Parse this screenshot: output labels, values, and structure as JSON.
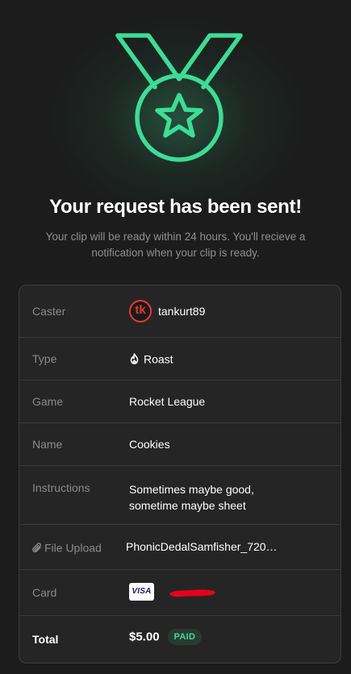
{
  "success": {
    "title": "Your request has been sent!",
    "subtitle": "Your clip will be ready within 24 hours. You'll recieve a notification when your clip is ready."
  },
  "details": {
    "caster_label": "Caster",
    "caster_value": "tankurt89",
    "caster_avatar_text": "tk",
    "type_label": "Type",
    "type_value": "Roast",
    "type_icon": "fire-icon",
    "game_label": "Game",
    "game_value": "Rocket League",
    "name_label": "Name",
    "name_value": "Cookies",
    "instructions_label": "Instructions",
    "instructions_line1": "Sometimes maybe good,",
    "instructions_line2": "sometime maybe sheet",
    "file_label": "File Upload",
    "file_icon": "paperclip-icon",
    "file_value": "PhonicDedalSamfisher_720…",
    "card_label": "Card",
    "card_brand": "VISA",
    "total_label": "Total",
    "total_value": "$5.00",
    "status_badge": "PAID"
  },
  "colors": {
    "accent": "#3ddc97",
    "background": "#1c1c1c",
    "card_bg": "#252525",
    "muted_text": "#8a8a8a",
    "avatar_red": "#e53935",
    "redaction_red": "#e8001c"
  }
}
